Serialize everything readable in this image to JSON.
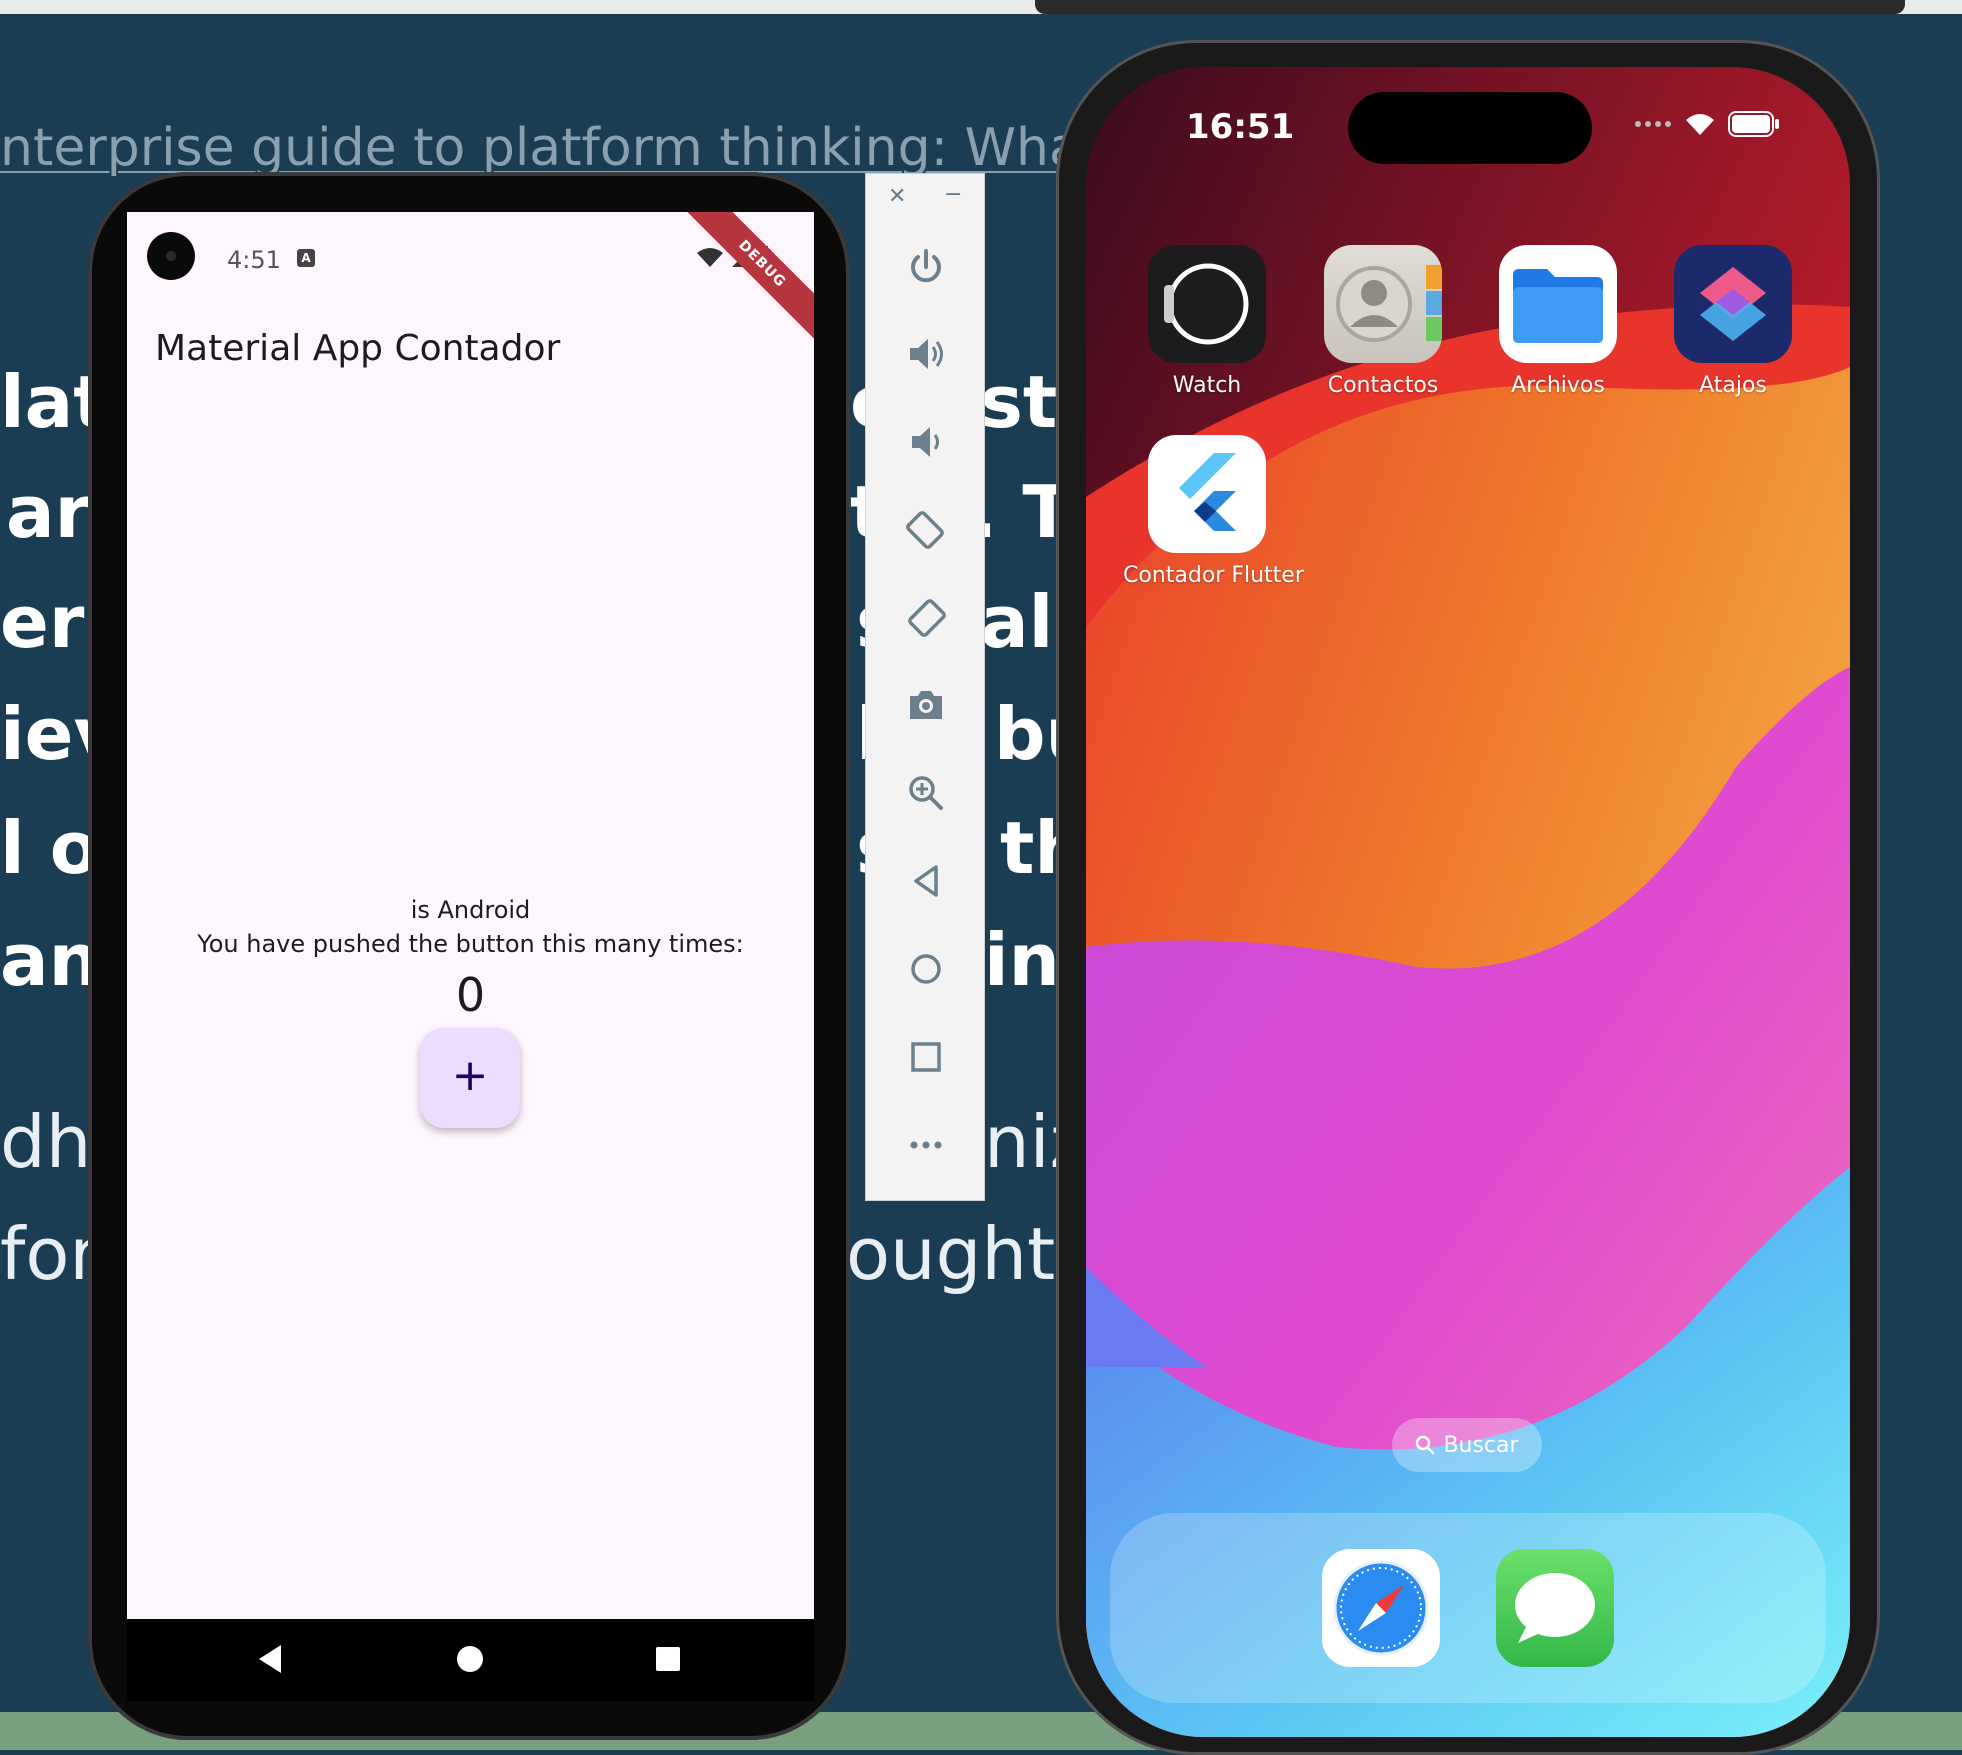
{
  "background": {
    "title_line": "nterprise guide to platform thinking: What it can",
    "left_fragments": [
      "lat",
      "ar",
      "ers",
      "iev",
      "l of",
      "ani",
      "dh",
      "for"
    ],
    "right_fragments": [
      "e",
      "st",
      "t",
      ". T",
      "s",
      "all",
      "b",
      "bu",
      "s",
      "th",
      "in",
      "niz",
      "oughtv"
    ]
  },
  "android": {
    "time": "4:51",
    "notification_badge": "A",
    "debug_banner": "DEBUG",
    "appbar_title": "Material App Contador",
    "platform_text": "is Android",
    "counter_label": "You have pushed the button this many times:",
    "counter_value": "0",
    "fab_label": "+"
  },
  "emulator_toolbar": {
    "close": "✕",
    "minimize": "−",
    "buttons": [
      "power-icon",
      "volume-up-icon",
      "volume-down-icon",
      "rotate-left-icon",
      "rotate-right-icon",
      "camera-icon",
      "zoom-icon",
      "back-icon",
      "home-icon",
      "overview-icon",
      "more-icon"
    ]
  },
  "iphone": {
    "time": "16:51",
    "apps": [
      {
        "label": "Watch"
      },
      {
        "label": "Contactos"
      },
      {
        "label": "Archivos"
      },
      {
        "label": "Atajos"
      },
      {
        "label": "Contador Flutter"
      }
    ],
    "search_label": "Buscar",
    "dock": [
      "safari-icon",
      "messages-icon"
    ]
  },
  "colors": {
    "page_bg": "#1b3d54",
    "android_screen": "#fdf7fd",
    "fab": "#eaddff",
    "debug": "#b7353e"
  }
}
